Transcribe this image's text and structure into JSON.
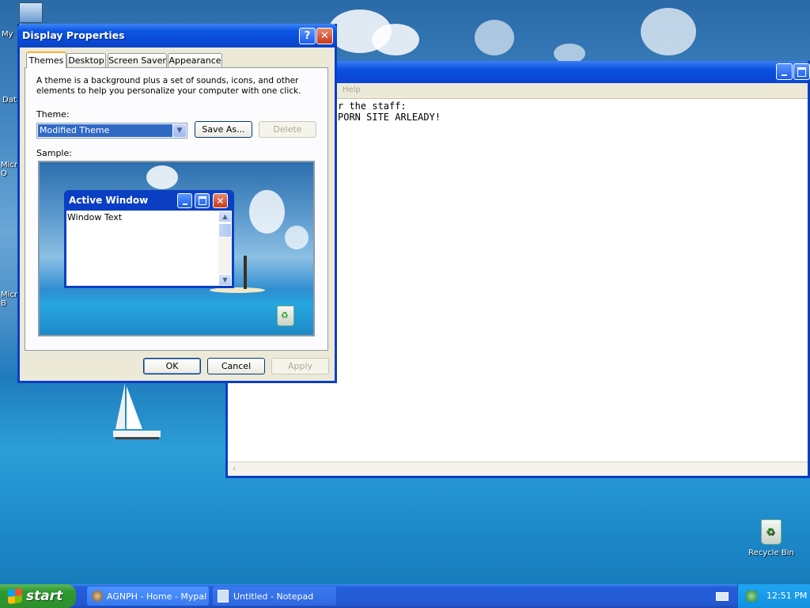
{
  "desktop": {
    "icons_left": [
      "My",
      "Dat",
      "Micro\nO",
      "Micro\nB"
    ],
    "recycle_bin_label": "Recycle Bin"
  },
  "notepad": {
    "menu_help": "Help",
    "text_line1": "r the staff:",
    "text_line2": "PORN SITE ARLEADY!"
  },
  "dialog": {
    "title": "Display Properties",
    "tabs": [
      "Themes",
      "Desktop",
      "Screen Saver",
      "Appearance"
    ],
    "description": "A theme is a background plus a set of sounds, icons, and other elements to help you personalize your computer with one click.",
    "theme_label": "Theme:",
    "theme_value": "Modified Theme",
    "save_as_label": "Save As...",
    "delete_label": "Delete",
    "sample_label": "Sample:",
    "sample": {
      "active_window_title": "Active Window",
      "window_text": "Window Text"
    },
    "ok_label": "OK",
    "cancel_label": "Cancel",
    "apply_label": "Apply"
  },
  "taskbar": {
    "start_label": "start",
    "tasks": [
      "AGNPH - Home - Mypal",
      "Untitled - Notepad"
    ],
    "clock": "12:51 PM"
  },
  "colors": {
    "title_blue": "#0a4ee0",
    "close_red": "#c8381d",
    "start_green": "#2f9a2f",
    "tab_highlight": "#f6b23c"
  }
}
